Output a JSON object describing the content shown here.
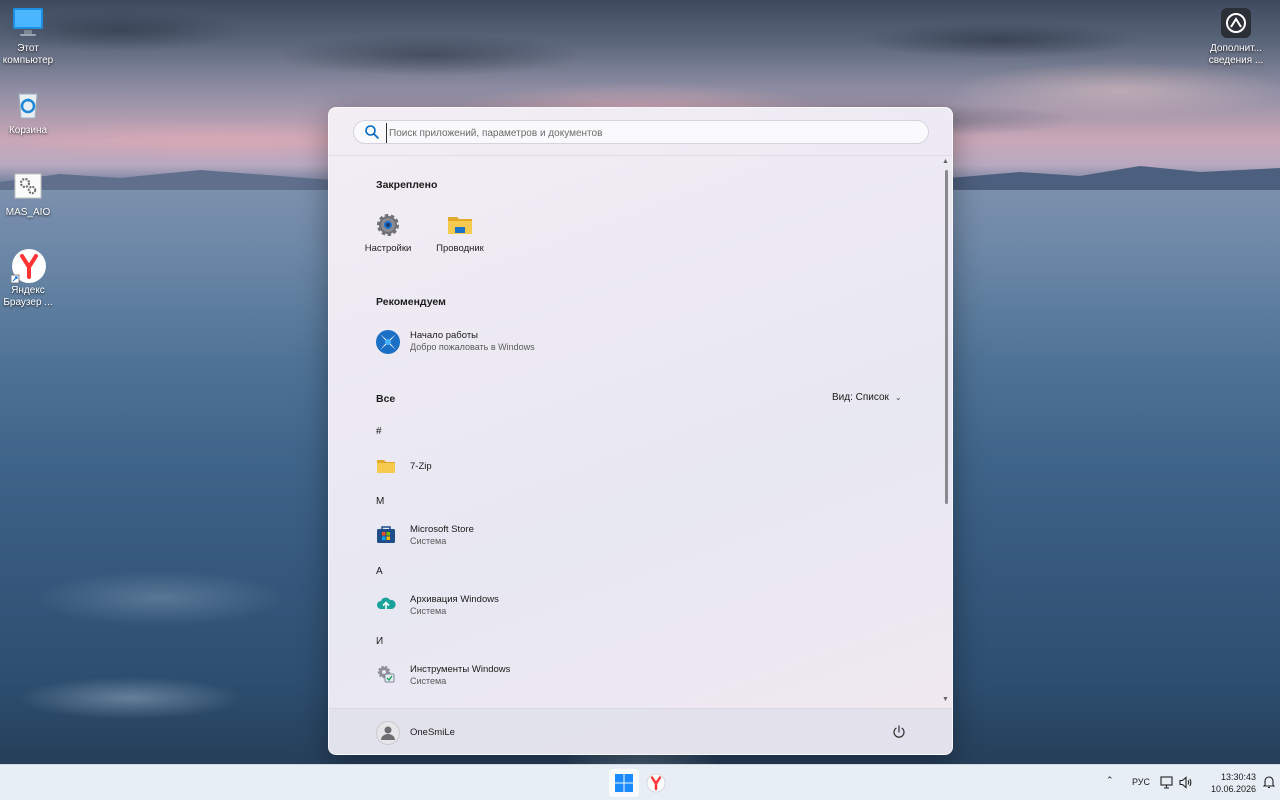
{
  "desktop": {
    "icons": [
      {
        "label": "Этот компьютер",
        "icon": "monitor-icon"
      },
      {
        "label": "Корзина",
        "icon": "recycle-bin-icon"
      },
      {
        "label": "MAS_AIO",
        "icon": "settings-script-icon"
      },
      {
        "label": "Яндекс Браузер ...",
        "icon": "yandex-browser-icon"
      },
      {
        "label": "Дополнит... сведения ...",
        "icon": "info-app-icon"
      }
    ]
  },
  "start_menu": {
    "search": {
      "placeholder": "Поиск приложений, параметров и документов"
    },
    "pinned": {
      "title": "Закреплено",
      "items": [
        {
          "label": "Настройки",
          "icon": "gear-icon"
        },
        {
          "label": "Проводник",
          "icon": "folder-icon"
        }
      ]
    },
    "recommended": {
      "title": "Рекомендуем",
      "items": [
        {
          "title": "Начало работы",
          "subtitle": "Добро пожаловать в Windows",
          "icon": "get-started-icon"
        }
      ]
    },
    "all": {
      "title": "Все",
      "view_label": "Вид: Список",
      "groups": [
        {
          "letter": "#",
          "apps": [
            {
              "name": "7-Zip",
              "subtitle": "",
              "icon": "folder-icon"
            }
          ]
        },
        {
          "letter": "M",
          "apps": [
            {
              "name": "Microsoft Store",
              "subtitle": "Система",
              "icon": "store-icon"
            }
          ]
        },
        {
          "letter": "A",
          "apps": [
            {
              "name": "Архивация Windows",
              "subtitle": "Система",
              "icon": "cloud-backup-icon"
            }
          ]
        },
        {
          "letter": "И",
          "apps": [
            {
              "name": "Инструменты Windows",
              "subtitle": "Система",
              "icon": "tools-icon"
            }
          ]
        }
      ]
    },
    "user": {
      "name": "OneSmiLe"
    }
  },
  "taskbar": {
    "language": "РУС",
    "time": "13:30:43",
    "date": "10.06.2026"
  },
  "colors": {
    "accent": "#0067c0",
    "folder": "#f2c14e"
  }
}
